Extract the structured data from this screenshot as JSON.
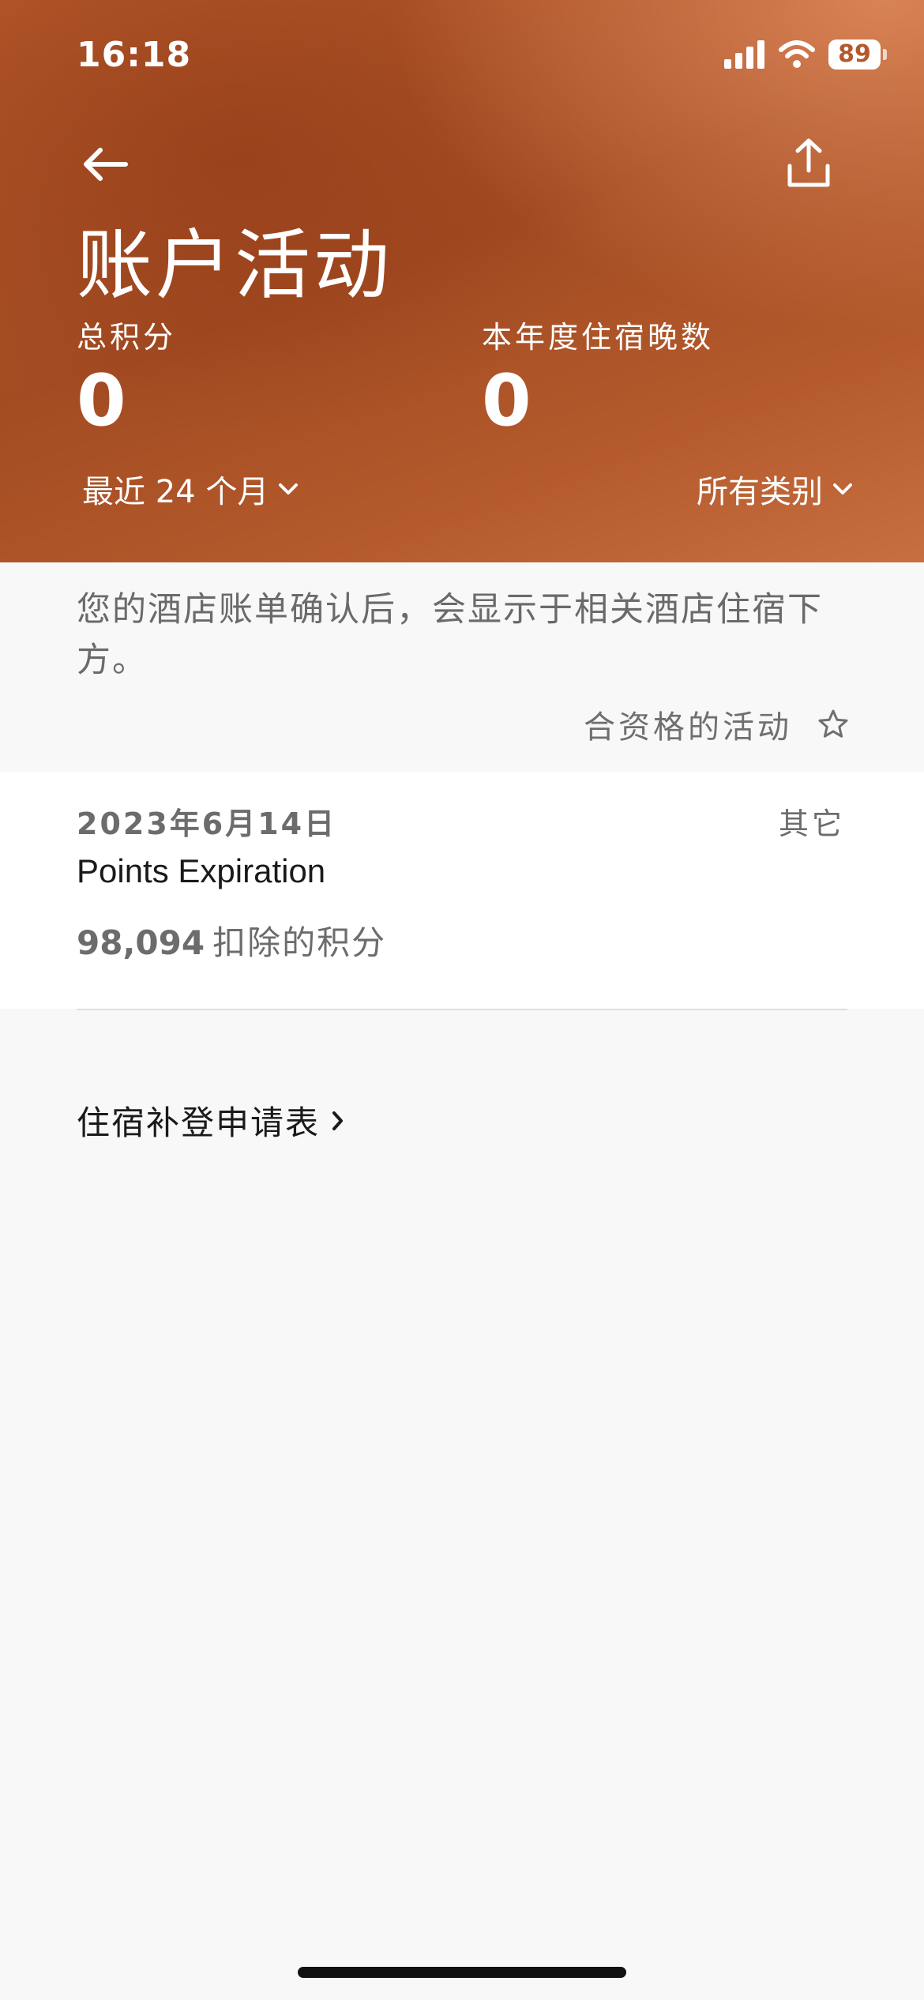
{
  "status_bar": {
    "time": "16:18",
    "battery": "89"
  },
  "header": {
    "title": "账户活动",
    "stats": {
      "points_label": "总积分",
      "points_value": "0",
      "nights_label": "本年度住宿晚数",
      "nights_value": "0"
    },
    "filters": {
      "period": "最近 24 个月",
      "category": "所有类别"
    }
  },
  "info": {
    "message": "您的酒店账单确认后，会显示于相关酒店住宿下方。",
    "eligible_label": "合资格的活动"
  },
  "activities": [
    {
      "date": "2023年6月14日",
      "category": "其它",
      "name": "Points Expiration",
      "points": "98,094",
      "points_label": "扣除的积分"
    }
  ],
  "footer": {
    "claim_link": "住宿补登申请表"
  },
  "colors": {
    "header": "#a84f25",
    "accent_light": "#d98050",
    "background": "#f8f8f8",
    "text_muted": "#6c6c6c"
  },
  "icons": [
    "signal-icon",
    "wifi-icon",
    "battery-icon",
    "back-arrow-icon",
    "share-icon",
    "chevron-down-icon",
    "star-outline-icon",
    "chevron-right-icon"
  ]
}
